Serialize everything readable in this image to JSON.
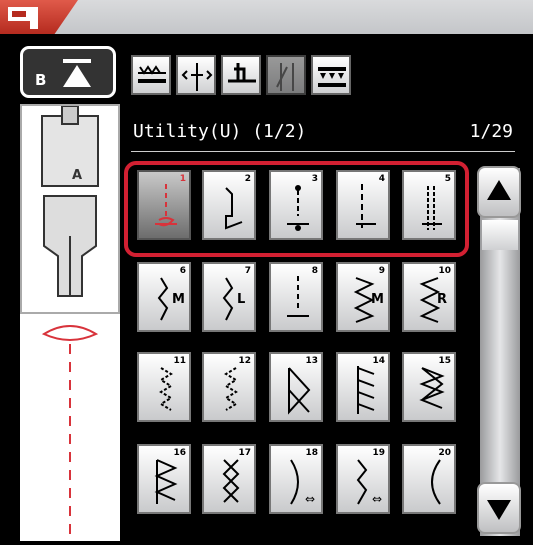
{
  "title": "Utility(U) (1/2)",
  "page_indicator": "1/29",
  "presser_foot": {
    "button_label": "B",
    "foot_code": "A"
  },
  "tool_icons": [
    "reverse-stitch-icon",
    "needle-position-icon",
    "pivot-icon",
    "twin-needle-icon",
    "stitch-density-icon"
  ],
  "stitches": [
    {
      "num": "1",
      "selected": true
    },
    {
      "num": "2"
    },
    {
      "num": "3"
    },
    {
      "num": "4"
    },
    {
      "num": "5"
    },
    {
      "num": "6"
    },
    {
      "num": "7"
    },
    {
      "num": "8"
    },
    {
      "num": "9"
    },
    {
      "num": "10"
    },
    {
      "num": "11"
    },
    {
      "num": "12"
    },
    {
      "num": "13"
    },
    {
      "num": "14"
    },
    {
      "num": "15"
    },
    {
      "num": "16"
    },
    {
      "num": "17"
    },
    {
      "num": "18"
    },
    {
      "num": "19"
    },
    {
      "num": "20"
    }
  ],
  "stitch_letters": {
    "6": "M",
    "7": "L",
    "9": "M",
    "10": "R"
  },
  "colors": {
    "accent": "#d22032",
    "selected_stitch": "#d8333b"
  }
}
